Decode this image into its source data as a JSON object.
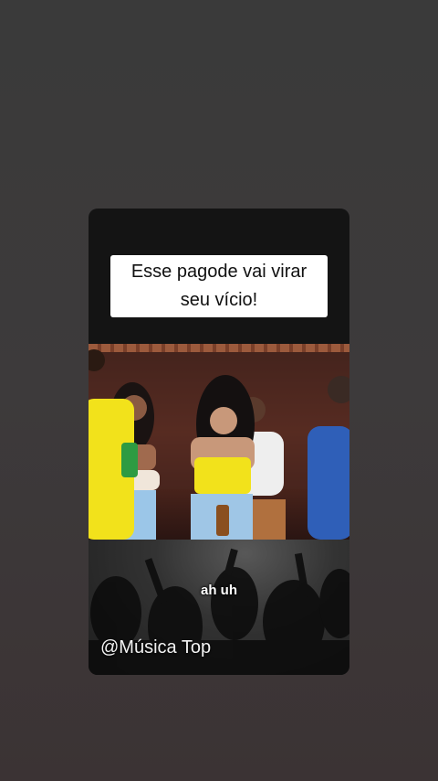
{
  "story": {
    "caption": "Esse pagode vai virar seu vício!",
    "lyric": "ah uh",
    "watermark": "@Música Top"
  },
  "colors": {
    "background": "#3b3b3b",
    "caption_bg": "#ffffff",
    "caption_text": "#111111",
    "shirt_yellow": "#f2e21b",
    "shirt_blue": "#2f5fb8"
  }
}
